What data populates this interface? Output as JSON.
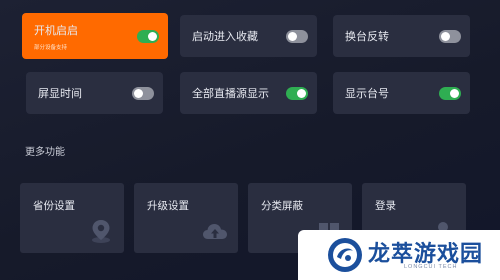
{
  "settings": {
    "boot_start": {
      "label": "开机启启",
      "sub": "部分设备支持",
      "on": true
    },
    "boot_to_favorites": {
      "label": "启动进入收藏",
      "on": false
    },
    "channel_reverse": {
      "label": "换台反转",
      "on": false
    },
    "screen_time": {
      "label": "屏显时间",
      "on": false
    },
    "all_live_sources": {
      "label": "全部直播源显示",
      "on": true
    },
    "show_channel_number": {
      "label": "显示台号",
      "on": true
    }
  },
  "more": {
    "title": "更多功能",
    "items": [
      {
        "label": "省份设置",
        "icon": "map-pin-icon"
      },
      {
        "label": "升级设置",
        "icon": "cloud-upload-icon"
      },
      {
        "label": "分类屏蔽",
        "icon": "grid-blocks-icon"
      },
      {
        "label": "登录",
        "icon": "user-icon"
      }
    ]
  },
  "watermark": {
    "title": "龙萃游戏园",
    "subtitle": "LONGCUI TECH"
  },
  "colors": {
    "accent": "#ff6a00",
    "toggle_on": "#2fae52",
    "toggle_off": "#8e919c",
    "tile": "#2a2e40"
  }
}
